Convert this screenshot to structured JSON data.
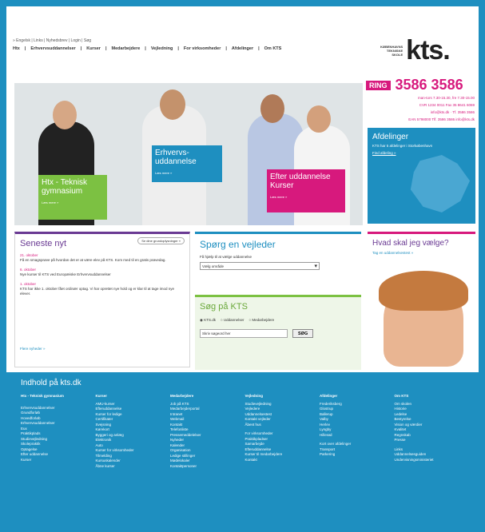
{
  "header": {
    "top_links": "» Engelsk | Links | Nyhedsbrev | Login | Søg",
    "nav": [
      "Htx",
      "Erhvervsuddannelser",
      "Kurser",
      "Medarbejdere",
      "Vejledning",
      "For virksomheder",
      "Afdelinger",
      "Om KTS"
    ],
    "logo_small": [
      "KØBENHAVNS",
      "TEKNISKE",
      "SKOLE"
    ],
    "logo_big": "kts.",
    "ring_label": "RING",
    "phone": "3586 3586",
    "info_lines": [
      "man-tors 7.30-15.30, fre 7.30-15.00",
      "CVR 1234 0011 Fax 35 8641 6069",
      "info@kts.dk · Tf. 3586 3586",
      "EAN 5798000 Tlf. 3586 3586 info@kts.dk"
    ]
  },
  "hero": {
    "htx_title": "Htx - Teknisk gymnasium",
    "htx_sub": "Læs mere »",
    "eud_title": "Erhvervs-uddannelse",
    "eud_sub": "Læs mere »",
    "efter_title": "Efter uddannelse Kurser",
    "efter_sub": "Læs mere »"
  },
  "afdelinger": {
    "title": "Afdelinger",
    "text": "KTS har 5 afdelinger i Storkøbenhavn",
    "link": "Find afdeling »"
  },
  "news": {
    "title": "Seneste nyt",
    "button": "Se dine grundoplysninger »",
    "items": [
      {
        "date": "21. oktober",
        "text": "Få en smagsprøve på hvordan det er at være elev på KTS. Kom med til en gratis prøvedag."
      },
      {
        "date": "6. oktober",
        "text": "Nye kurser til KTS ved Europæiske Erhvervsuddannelser"
      },
      {
        "date": "1. oktober",
        "text": "KTS har ikke 1. oktober fået ordinær optag. Vi har oprettet nye hold og er klar til at tage imod nye elever."
      }
    ],
    "more": "Flere nyheder »"
  },
  "vejleder": {
    "title": "Spørg en vejleder",
    "sub": "Få hjælp til at vælge uddannelse",
    "select_value": "Vælg område"
  },
  "search": {
    "title": "Søg på KTS",
    "radios": [
      "KTS.dk",
      "Uddannelser",
      "Medarbejdere"
    ],
    "placeholder": "Skriv søgeord her",
    "button": "SØG"
  },
  "hvad": {
    "title": "Hvad skal jeg vælge?",
    "link": "Tag en uddannelsestest »"
  },
  "footer": {
    "title": "Indhold på kts.dk",
    "cols": [
      {
        "head": "Htx - Teknisk gymnasium",
        "items": [
          "",
          "Erhvervsuddannelser",
          "Grundforløb",
          "Hovedforløb",
          "Erhvervsuddannelser",
          "Eux",
          "Praktikplads",
          "Studievejledning",
          "Skolepraktik",
          "Optagelse",
          "Efter uddannelse",
          "Kurser"
        ]
      },
      {
        "head": "Kurser",
        "items": [
          "AMU-kurser",
          "Efteruddannelse",
          "Kurser for ledige",
          "Certifikater",
          "Svejsning",
          "Kørekort",
          "Byggeri og anlæg",
          "Elektronik",
          "Auto",
          "Kurser for virksomheder",
          "Tilmelding",
          "Kursuskalender",
          "Åbne kurser"
        ]
      },
      {
        "head": "Medarbejdere",
        "items": [
          "Job på KTS",
          "Medarbejderportal",
          "Intranet",
          "Webmail",
          "Kontakt",
          "Telefonliste",
          "Pressemeddelelser",
          "Nyheder",
          "Kalender",
          "Organisation",
          "Ledige stillinger",
          "Mødelokaler",
          "Kontaktpersoner"
        ]
      },
      {
        "head": "Vejledning",
        "items": [
          "Studievejledning",
          "Vejledere",
          "Uddannelsestest",
          "Kontakt vejleder",
          "Åbent hus",
          "",
          "For virksomheder",
          "Praktikpladser",
          "Samarbejde",
          "Efteruddannelse",
          "Kurser til medarbejdere",
          "Kontakt"
        ]
      },
      {
        "head": "Afdelinger",
        "items": [
          "Frederiksberg",
          "Glostrup",
          "Ballerup",
          "Valby",
          "Herlev",
          "Lyngby",
          "Hillerød",
          "",
          "Kort over afdelinger",
          "Transport",
          "Parkering"
        ]
      },
      {
        "head": "Om KTS",
        "items": [
          "Om skolen",
          "Historie",
          "Ledelse",
          "Bestyrelse",
          "Vision og værdier",
          "Kvalitet",
          "Regnskab",
          "Presse",
          "",
          "Links",
          "Uddannelsesguiden",
          "Undervisningsministeriet"
        ]
      }
    ]
  }
}
